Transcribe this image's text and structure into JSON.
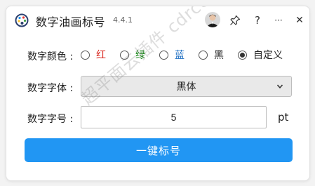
{
  "window": {
    "title": "数字油画标号",
    "version": "4.4.1"
  },
  "titlebar_buttons": {
    "help": "?",
    "more": "···",
    "close": "✕"
  },
  "color_row": {
    "label": "数字颜色 :",
    "options": [
      {
        "label": "红",
        "color": "#d9251d",
        "selected": false
      },
      {
        "label": "绿",
        "color": "#1e8a1e",
        "selected": false
      },
      {
        "label": "蓝",
        "color": "#1f6fc2",
        "selected": false
      },
      {
        "label": "黑",
        "color": "#222222",
        "selected": false
      },
      {
        "label": "自定义",
        "color": "#222222",
        "selected": true
      }
    ]
  },
  "font_row": {
    "label": "数字字体 :",
    "selected": "黑体"
  },
  "size_row": {
    "label": "数字字号 :",
    "value": "5",
    "unit": "pt"
  },
  "action": {
    "label": "一键标号"
  },
  "watermark": "超平面云插件 cdrccp.com",
  "colors": {
    "accent": "#2196f3"
  }
}
